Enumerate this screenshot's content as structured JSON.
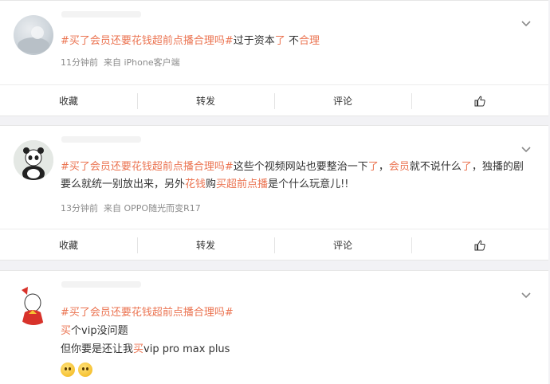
{
  "hashtag": "#买了会员还要花钱超前点播合理吗#",
  "posts": [
    {
      "text_after_tag_1": "过于资本",
      "text_after_tag_2": "了",
      "text_after_tag_3": " 不",
      "text_after_tag_4": "合理",
      "time": "11分钟前",
      "source": "来自 iPhone客户端"
    },
    {
      "seg_1": "这些个视频网站也要整治一下",
      "seg_2": "了",
      "seg_3": "，",
      "seg_4": "会员",
      "seg_5": "就不说什么",
      "seg_6": "了",
      "seg_7": "，独播的剧要么就统一别放出来，另外",
      "seg_8": "花钱",
      "seg_9": "购",
      "seg_10": "买超前点播",
      "seg_11": "是个什么玩意儿!!",
      "time": "13分钟前",
      "source": "来自 OPPO随光而变R17"
    },
    {
      "line1_a": "买",
      "line1_b": "个vip没问题",
      "line2_a": "但你要是还让我",
      "line2_b": "买",
      "line2_c": "vip pro max plus"
    }
  ],
  "actions": {
    "favorite": "收藏",
    "repost": "转发",
    "comment": "评论"
  },
  "icons": [
    "chevron-down-icon",
    "thumbs-up-icon",
    "emoji-icon"
  ],
  "colors": {
    "highlight": "#eb7350",
    "meta": "#8c8c8c"
  }
}
